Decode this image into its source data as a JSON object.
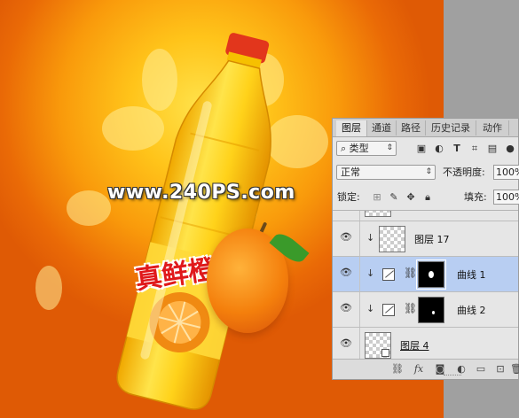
{
  "canvas": {
    "watermark": "www.240PS.com",
    "product_label": "真鲜橙"
  },
  "layers_panel": {
    "tabs": [
      {
        "label": "图层",
        "active": true
      },
      {
        "label": "通道",
        "active": false
      },
      {
        "label": "路径",
        "active": false
      },
      {
        "label": "历史记录",
        "active": false
      },
      {
        "label": "动作",
        "active": false
      }
    ],
    "filter": {
      "icon": "search-icon",
      "label": "类型"
    },
    "blend_mode": "正常",
    "opacity_label": "不透明度:",
    "opacity_value": "100%",
    "lock_label": "锁定:",
    "fill_label": "填充:",
    "fill_value": "100%",
    "layers": [
      {
        "name": "图层 17",
        "kind": "pixel",
        "clipped": true,
        "selected": false
      },
      {
        "name": "曲线 1",
        "kind": "curves",
        "clipped": true,
        "selected": true
      },
      {
        "name": "曲线 2",
        "kind": "curves",
        "clipped": true,
        "selected": false
      },
      {
        "name": "图层 4",
        "kind": "smart-object",
        "clipped": false,
        "selected": false
      }
    ],
    "bottom_icons": [
      "link-icon",
      "fx-icon",
      "mask-icon",
      "adjustment-icon",
      "folder-icon",
      "new-layer-icon",
      "trash-icon"
    ],
    "colors": {
      "selected_row": "#b8cef2",
      "panel_bg": "#e6e6e6"
    }
  }
}
